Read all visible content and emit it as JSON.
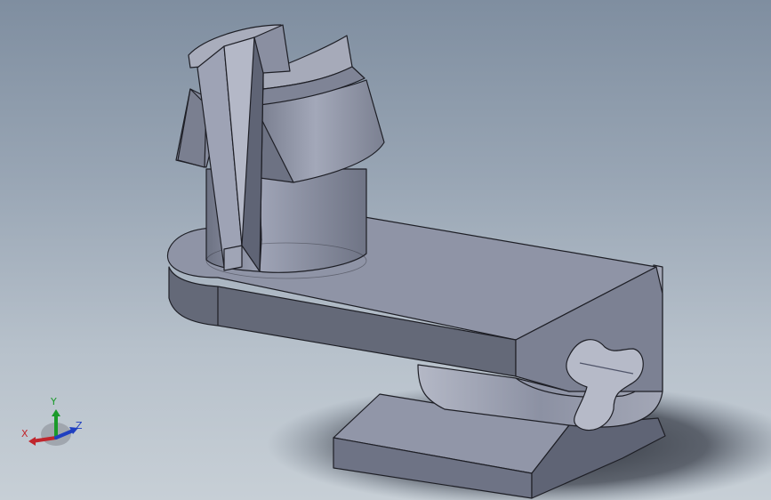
{
  "viewport": {
    "background_top": "#7f8ea0",
    "background_bottom": "#c7cfd6"
  },
  "model": {
    "body_color": "#8d93a6",
    "edge_color": "#1e1f26"
  },
  "triad": {
    "x_label": "X",
    "y_label": "Y",
    "z_label": "Z",
    "x_color": "#c0262d",
    "y_color": "#1a9a2a",
    "z_color": "#1f3fc0"
  }
}
